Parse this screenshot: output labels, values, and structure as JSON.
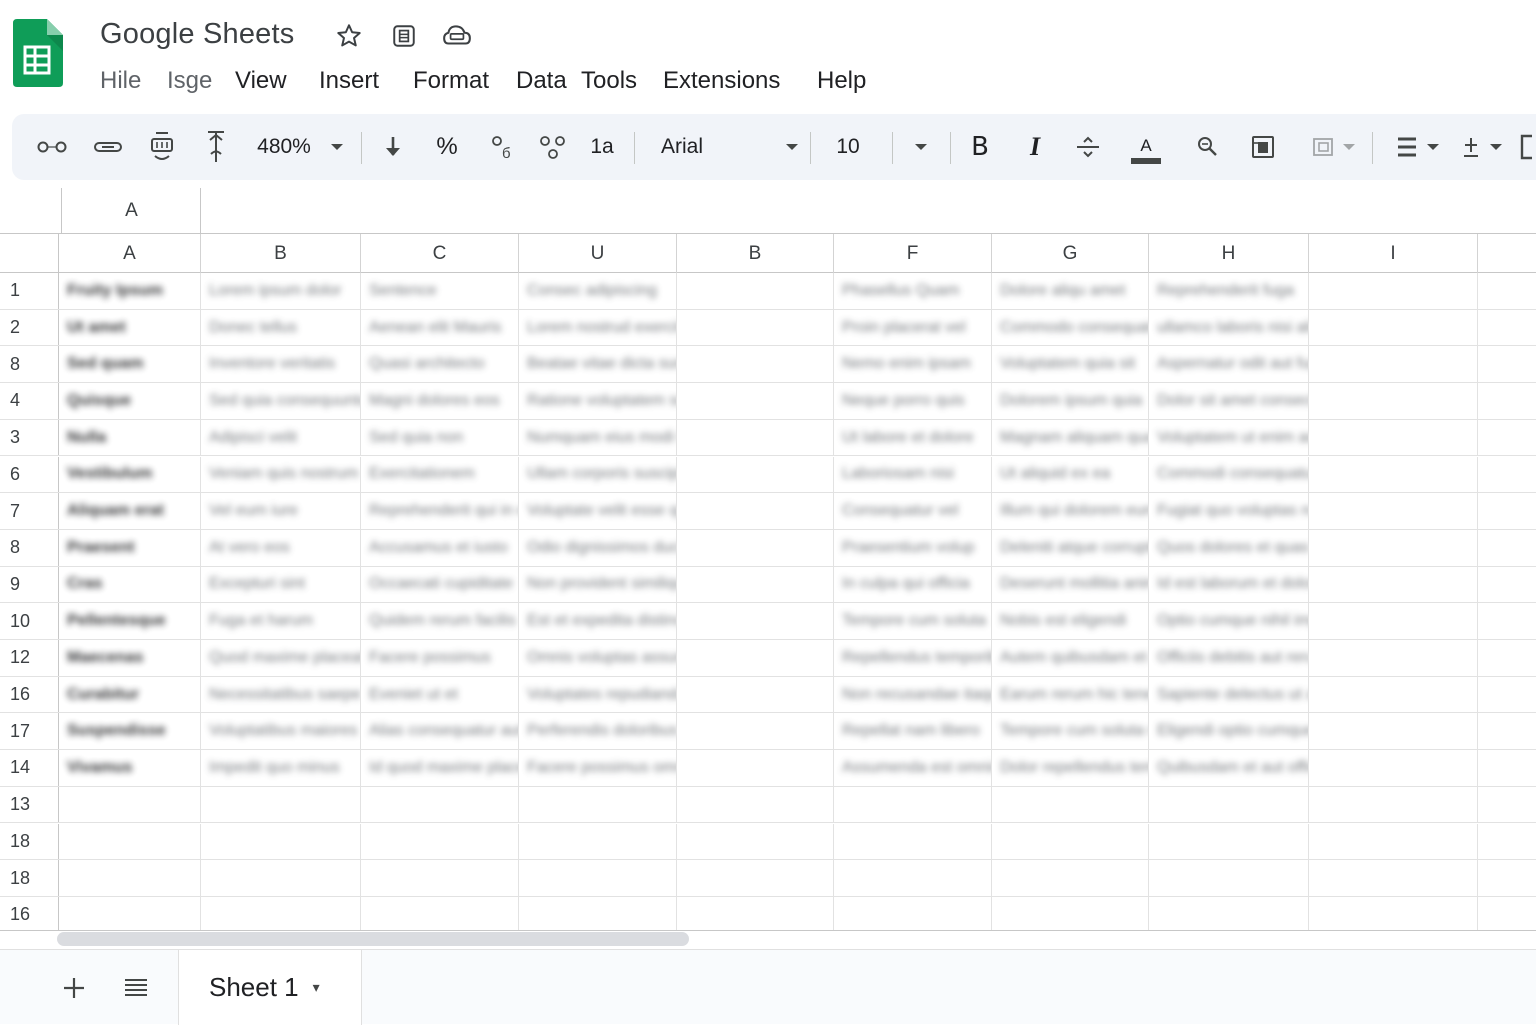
{
  "app": {
    "title": "Google Sheets",
    "brand_color": "#0f9d58"
  },
  "title_icons": [
    "star-icon",
    "move-to-folder-icon",
    "cloud-status-icon"
  ],
  "menu": {
    "items": [
      {
        "label": "Hile",
        "dim": true
      },
      {
        "label": "Isge",
        "dim": true
      },
      {
        "label": "View",
        "dim": false
      },
      {
        "label": "Insert",
        "dim": false
      },
      {
        "label": "Format",
        "dim": false
      },
      {
        "label": "Data",
        "dim": false
      },
      {
        "label": "Tools",
        "dim": false
      },
      {
        "label": "Extensions",
        "dim": false
      },
      {
        "label": "Help",
        "dim": false
      }
    ]
  },
  "toolbar": {
    "zoom": "480%",
    "percent": "%",
    "number_format": "1a",
    "font": "Arial",
    "font_size": "10",
    "bold": "B",
    "italic": "I",
    "text_color_letter": "A"
  },
  "formula": {
    "name_box": "A"
  },
  "columns": [
    "A",
    "B",
    "C",
    "U",
    "B",
    "F",
    "G",
    "H",
    "I"
  ],
  "row_numbers": [
    "1",
    "2",
    "8",
    "4",
    "3",
    "6",
    "7",
    "8",
    "9",
    "10",
    "12",
    "16",
    "17",
    "14",
    "13",
    "18",
    "18",
    "16"
  ],
  "rows": [
    [
      "Fruity Ipsum",
      "Lorem ipsum dolor",
      "Sentence",
      "Consec adipiscing",
      "",
      "Phasellus Quam",
      "Dolore aliqu amet",
      "Reprehenderit fuga",
      ""
    ],
    [
      "Ut amet",
      "Donec tellus",
      "Aenean elit Mauris",
      "Lorem nostrud exercitation ullamco",
      "",
      "Proin placerat vel",
      "Commodo consequat ad",
      "ullamco laboris nisi aliquip",
      ""
    ],
    [
      "Sed quam",
      "Inventore veritatis",
      "Quasi architecto",
      "Beatae vitae dicta sunt explicabo",
      "",
      "Nemo enim ipsam",
      "Voluptatem quia sit",
      "Aspernatur odit aut fugit",
      ""
    ],
    [
      "Quisque",
      "Sed quia consequuntur",
      "Magni dolores eos",
      "Ratione voluptatem sequi nesciunt",
      "",
      "Neque porro quis",
      "Dolorem ipsum quia",
      "Dolor sit amet consectetur",
      ""
    ],
    [
      "Nulla",
      "Adipisci velit",
      "Sed quia non",
      "Numquam eius modi tempora incidunt",
      "",
      "Ut labore et dolore",
      "Magnam aliquam quaerat",
      "Voluptatem ut enim ad minima",
      ""
    ],
    [
      "Vestibulum",
      "Veniam quis nostrum",
      "Exercitationem",
      "Ullam corporis suscipit",
      "",
      "Laboriosam nisi",
      "Ut aliquid ex ea",
      "Commodi consequatur quis autem",
      ""
    ],
    [
      "Aliquam erat",
      "Vel eum iure",
      "Reprehenderit qui in ea",
      "Voluptate velit esse quam nihil molestiae",
      "",
      "Consequatur vel",
      "Illum qui dolorem eum",
      "Fugiat quo voluptas nulla",
      ""
    ],
    [
      "Praesent",
      "At vero eos",
      "Accusamus et iusto",
      "Odio dignissimos ducimus qui blanditiis",
      "",
      "Praesentium volup",
      "Deleniti atque corrupti",
      "Quos dolores et quas molestias",
      ""
    ],
    [
      "Cras",
      "Excepturi sint",
      "Occaecati cupiditate",
      "Non provident similique sunt",
      "",
      "In culpa qui officia",
      "Deserunt mollitia animi",
      "Id est laborum et dolorum",
      ""
    ],
    [
      "Pellentesque",
      "Fuga et harum",
      "Quidem rerum facilis",
      "Est et expedita distinctio nam libero",
      "",
      "Tempore cum soluta",
      "Nobis est eligendi",
      "Optio cumque nihil impedit quo minus",
      ""
    ],
    [
      "Maecenas",
      "Quod maxime placeat",
      "Facere possimus",
      "Omnis voluptas assumenda est omnis dolor",
      "",
      "Repellendus temporibus",
      "Autem quibusdam et aut",
      "Officiis debitis aut rerum",
      ""
    ],
    [
      "Curabitur",
      "Necessitatibus saepe",
      "Eveniet ut et",
      "Voluptates repudiandae sint et molestiae",
      "",
      "Non recusandae itaque",
      "Earum rerum hic tenetur",
      "Sapiente delectus ut aut reiciendis",
      ""
    ],
    [
      "Suspendisse",
      "Voluptatibus maiores",
      "Alias consequatur aut",
      "Perferendis doloribus asperiores",
      "",
      "Repellat nam libero",
      "Tempore cum soluta nobis",
      "Eligendi optio cumque nihil",
      ""
    ],
    [
      "Vivamus",
      "Impedit quo minus",
      "Id quod maxime placeat",
      "Facere possimus omnis voluptas",
      "",
      "Assumenda est omnis",
      "Dolor repellendus temp",
      "Quibusdam et aut officiis",
      ""
    ]
  ],
  "empty_rows": 4,
  "sheet": {
    "tab_label": "Sheet 1"
  }
}
